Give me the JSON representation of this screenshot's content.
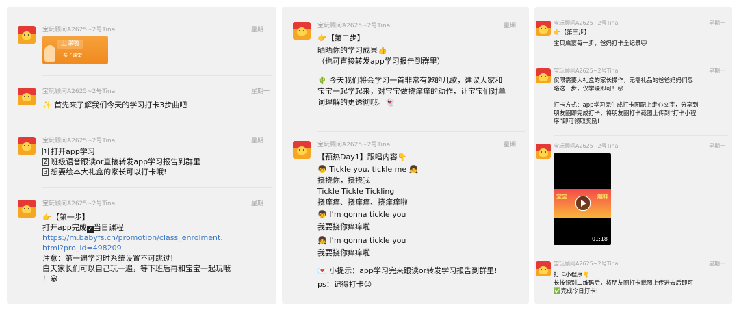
{
  "panels": [
    {
      "messages": [
        {
          "sender": "宝玩顾问A2625~2号Tina",
          "time": "星期一",
          "image": {
            "tag": "上课啦",
            "sub": "亲子课堂"
          }
        },
        {
          "sender": "宝玩顾问A2625~2号Tina",
          "time": "星期一",
          "lines": [
            "✨ 首先来了解我们今天的学习打卡3步曲吧"
          ]
        },
        {
          "sender": "宝玩顾问A2625~2号Tina",
          "time": "星期一",
          "lines": [
            "打开app学习",
            "班级语音跟读or直接转发app学习报告到群里",
            "想要绘本大礼盒的家长可以打卡哦!"
          ],
          "nums": [
            "1",
            "2",
            "3"
          ]
        },
        {
          "sender": "宝玩顾问A2625~2号Tina",
          "time": "星期一",
          "lines": [
            "👉【第一步】",
            "打开app完成",
            "当日课程",
            "https://m.babyfs.cn/promotion/class_enrolment.",
            "html?pro_id=498209",
            "注意：第一遍学习时系统设置不可跳过!",
            "白天家长们可以自己玩一遍，等下班后再和宝宝一起玩哦",
            "！😀"
          ]
        }
      ]
    },
    {
      "messages": [
        {
          "sender": "宝玩顾问A2625~2号Tina",
          "time": "星期一",
          "lines": [
            "👉【第二步】",
            "晒晒你的学习成果👍",
            "（也可直接转发app学习报告到群里）",
            "🌵 今天我们将会学习一首非常有趣的儿歌，建议大家和",
            "宝宝一起学起来，对宝宝做挠痒痒的动作，让宝宝们对单",
            "词理解的更透彻哦。👻"
          ]
        },
        {
          "sender": "宝玩顾问A2625~2号Tina",
          "time": "星期一",
          "lines": [
            "【预热Day1】跟唱内容👇",
            "👦 Tickle you, tickle me 👧",
            "挠挠你，挠挠我",
            "Tickle Tickle Tickling",
            "挠痒痒、挠痒痒、挠痒痒啦",
            "👦 I’m gonna tickle you",
            "我要挠你痒痒啦",
            "👧 I’m gonna tickle you",
            "我要挠你痒痒啦",
            "💌 小提示：app学习完来跟读or转发学习报告到群里!",
            "ps：记得打卡😉"
          ]
        }
      ]
    },
    {
      "messages": [
        {
          "sender": "宝玩顾问A2625~2号Tina",
          "time": "星期一",
          "lines": [
            "👉【第三步】",
            "宝贝启蒙每一步，爸妈打卡全纪录🐱"
          ]
        },
        {
          "sender": "宝玩顾问A2625~2号Tina",
          "time": "星期一",
          "lines": [
            "仅限需要大礼盒的家长操作，无需礼品的爸爸妈妈们忽",
            "略这一步，仅学课即可！😜",
            "打卡方式：app学习完生成打卡图配上走心文字，分享到",
            "朋友圈即完成打卡，将朋友圈打卡截图上传到“打卡小程",
            "序”即可领取奖励!"
          ]
        },
        {
          "sender": "宝玩顾问A2625~2号Tina",
          "time": "星期一",
          "video": {
            "left": "宝宝",
            "right": "趣味",
            "duration": "01:18"
          }
        },
        {
          "sender": "宝玩顾问A2625~2号Tina",
          "time": "星期一",
          "lines": [
            "打卡小程序👇",
            "长按识别二维码后，将朋友圈打卡截图上传进去后即可",
            "✅完成今日打卡!"
          ]
        }
      ]
    }
  ]
}
